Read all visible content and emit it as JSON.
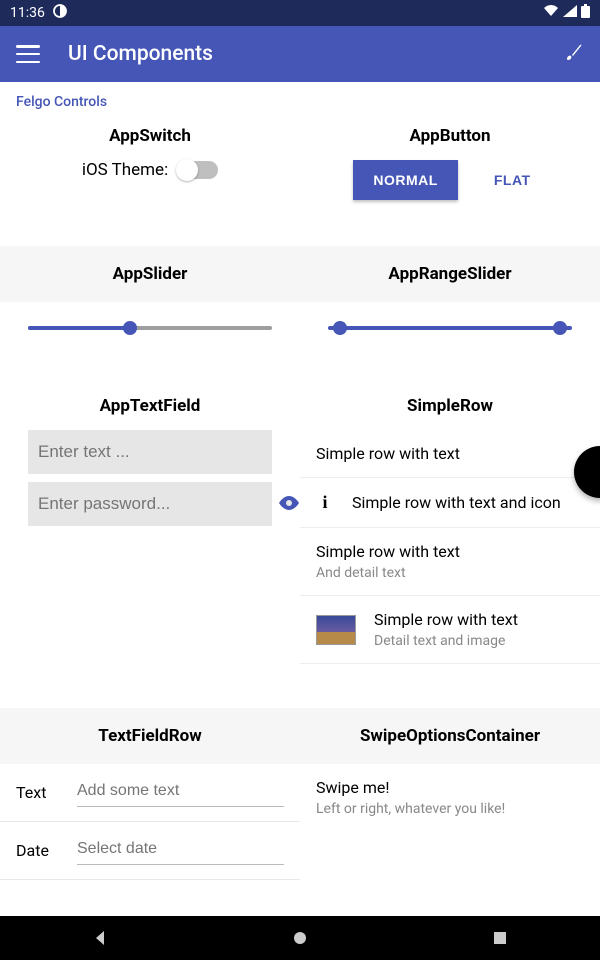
{
  "status": {
    "time": "11:36"
  },
  "appbar": {
    "title": "UI Components"
  },
  "section_label": "Felgo Controls",
  "appswitch": {
    "title": "AppSwitch",
    "label": "iOS Theme:"
  },
  "appbutton": {
    "title": "AppButton",
    "normal": "NORMAL",
    "flat": "FLAT"
  },
  "appslider": {
    "title": "AppSlider",
    "value_pct": 42
  },
  "apprangeslider": {
    "title": "AppRangeSlider",
    "low_pct": 5,
    "high_pct": 95
  },
  "apptextfield": {
    "title": "AppTextField",
    "text_placeholder": "Enter text ...",
    "password_placeholder": "Enter password..."
  },
  "simplerow": {
    "title": "SimpleRow",
    "items": [
      {
        "title": "Simple row with text"
      },
      {
        "title": "Simple row with text and icon",
        "icon": "info"
      },
      {
        "title": "Simple row with text",
        "detail": "And detail text"
      },
      {
        "title": "Simple row with text",
        "detail": "Detail text and image",
        "image": true
      }
    ]
  },
  "textfieldrow": {
    "title": "TextFieldRow",
    "rows": [
      {
        "label": "Text",
        "placeholder": "Add some text"
      },
      {
        "label": "Date",
        "placeholder": "Select date"
      }
    ]
  },
  "swipe": {
    "title": "SwipeOptionsContainer",
    "item_title": "Swipe me!",
    "item_detail": "Left or right, whatever you like!"
  }
}
